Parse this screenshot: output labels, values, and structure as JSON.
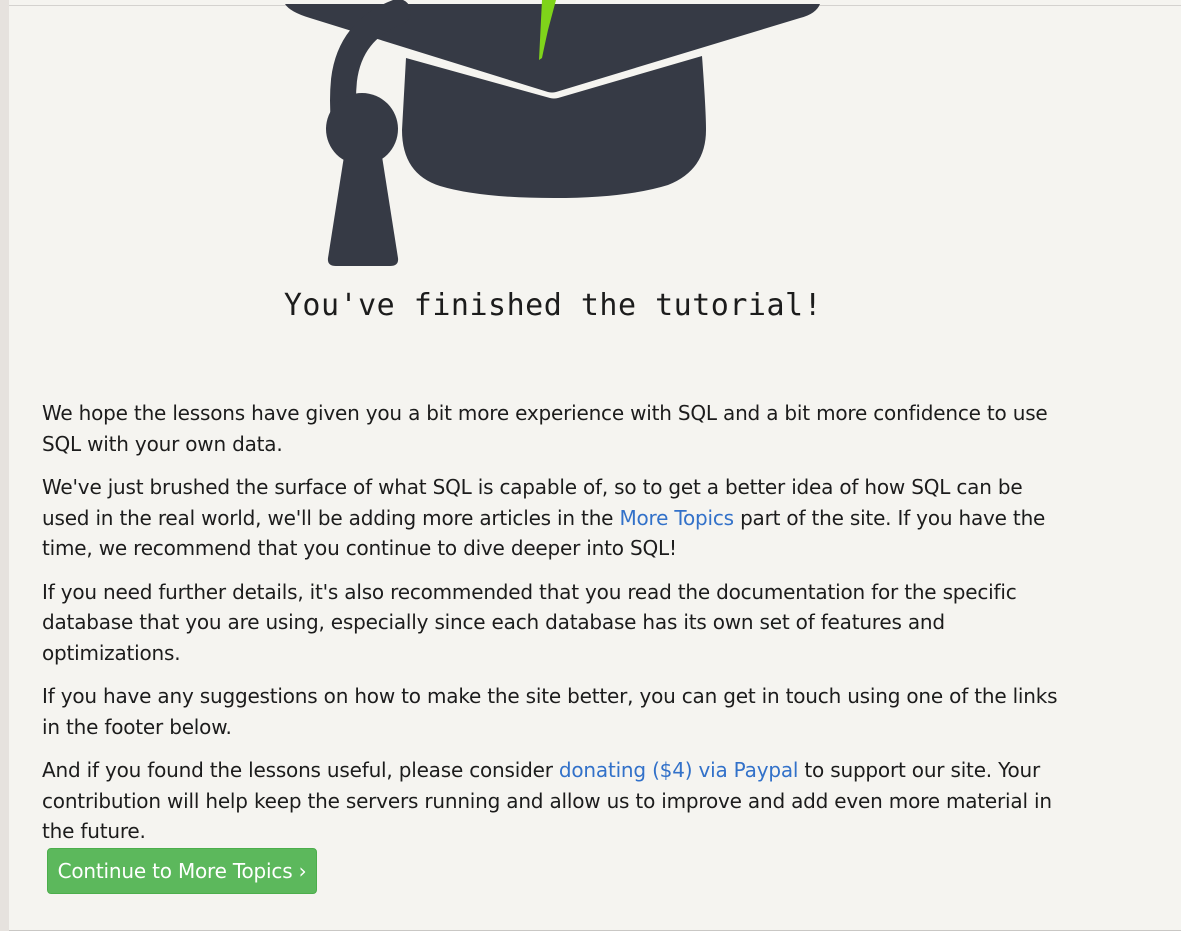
{
  "page": {
    "title": "You've finished the tutorial!",
    "paragraphs": [
      {
        "text": "We hope the lessons have given you a bit more experience with SQL and a bit more confidence to use SQL with your own data."
      },
      {
        "before": "We've just brushed the surface of what SQL is capable of, so to get a better idea of how SQL can be used in the real world, we'll be adding more articles in the ",
        "link": "More Topics",
        "after": " part of the site. If you have the time, we recommend that you continue to dive deeper into SQL!"
      },
      {
        "text": "If you need further details, it's also recommended that you read the documentation for the specific database that you are using, especially since each database has its own set of features and optimizations."
      },
      {
        "text": "If you have any suggestions on how to make the site better, you can get in touch using one of the links in the footer below."
      },
      {
        "before": "And if you found the lessons useful, please consider ",
        "link": "donating ($4) via Paypal",
        "after": " to support our site. Your contribution will help keep the servers running and allow us to improve and add even more material in the future."
      }
    ],
    "continue_button": "Continue to More Topics ›"
  },
  "illustration": {
    "icon": "graduation-cap-icon",
    "cap_color": "#363a45",
    "tassel_accent": "#7fd41a"
  },
  "colors": {
    "background": "#f5f4f0",
    "link": "#3271c9",
    "button": "#5cb85c"
  }
}
